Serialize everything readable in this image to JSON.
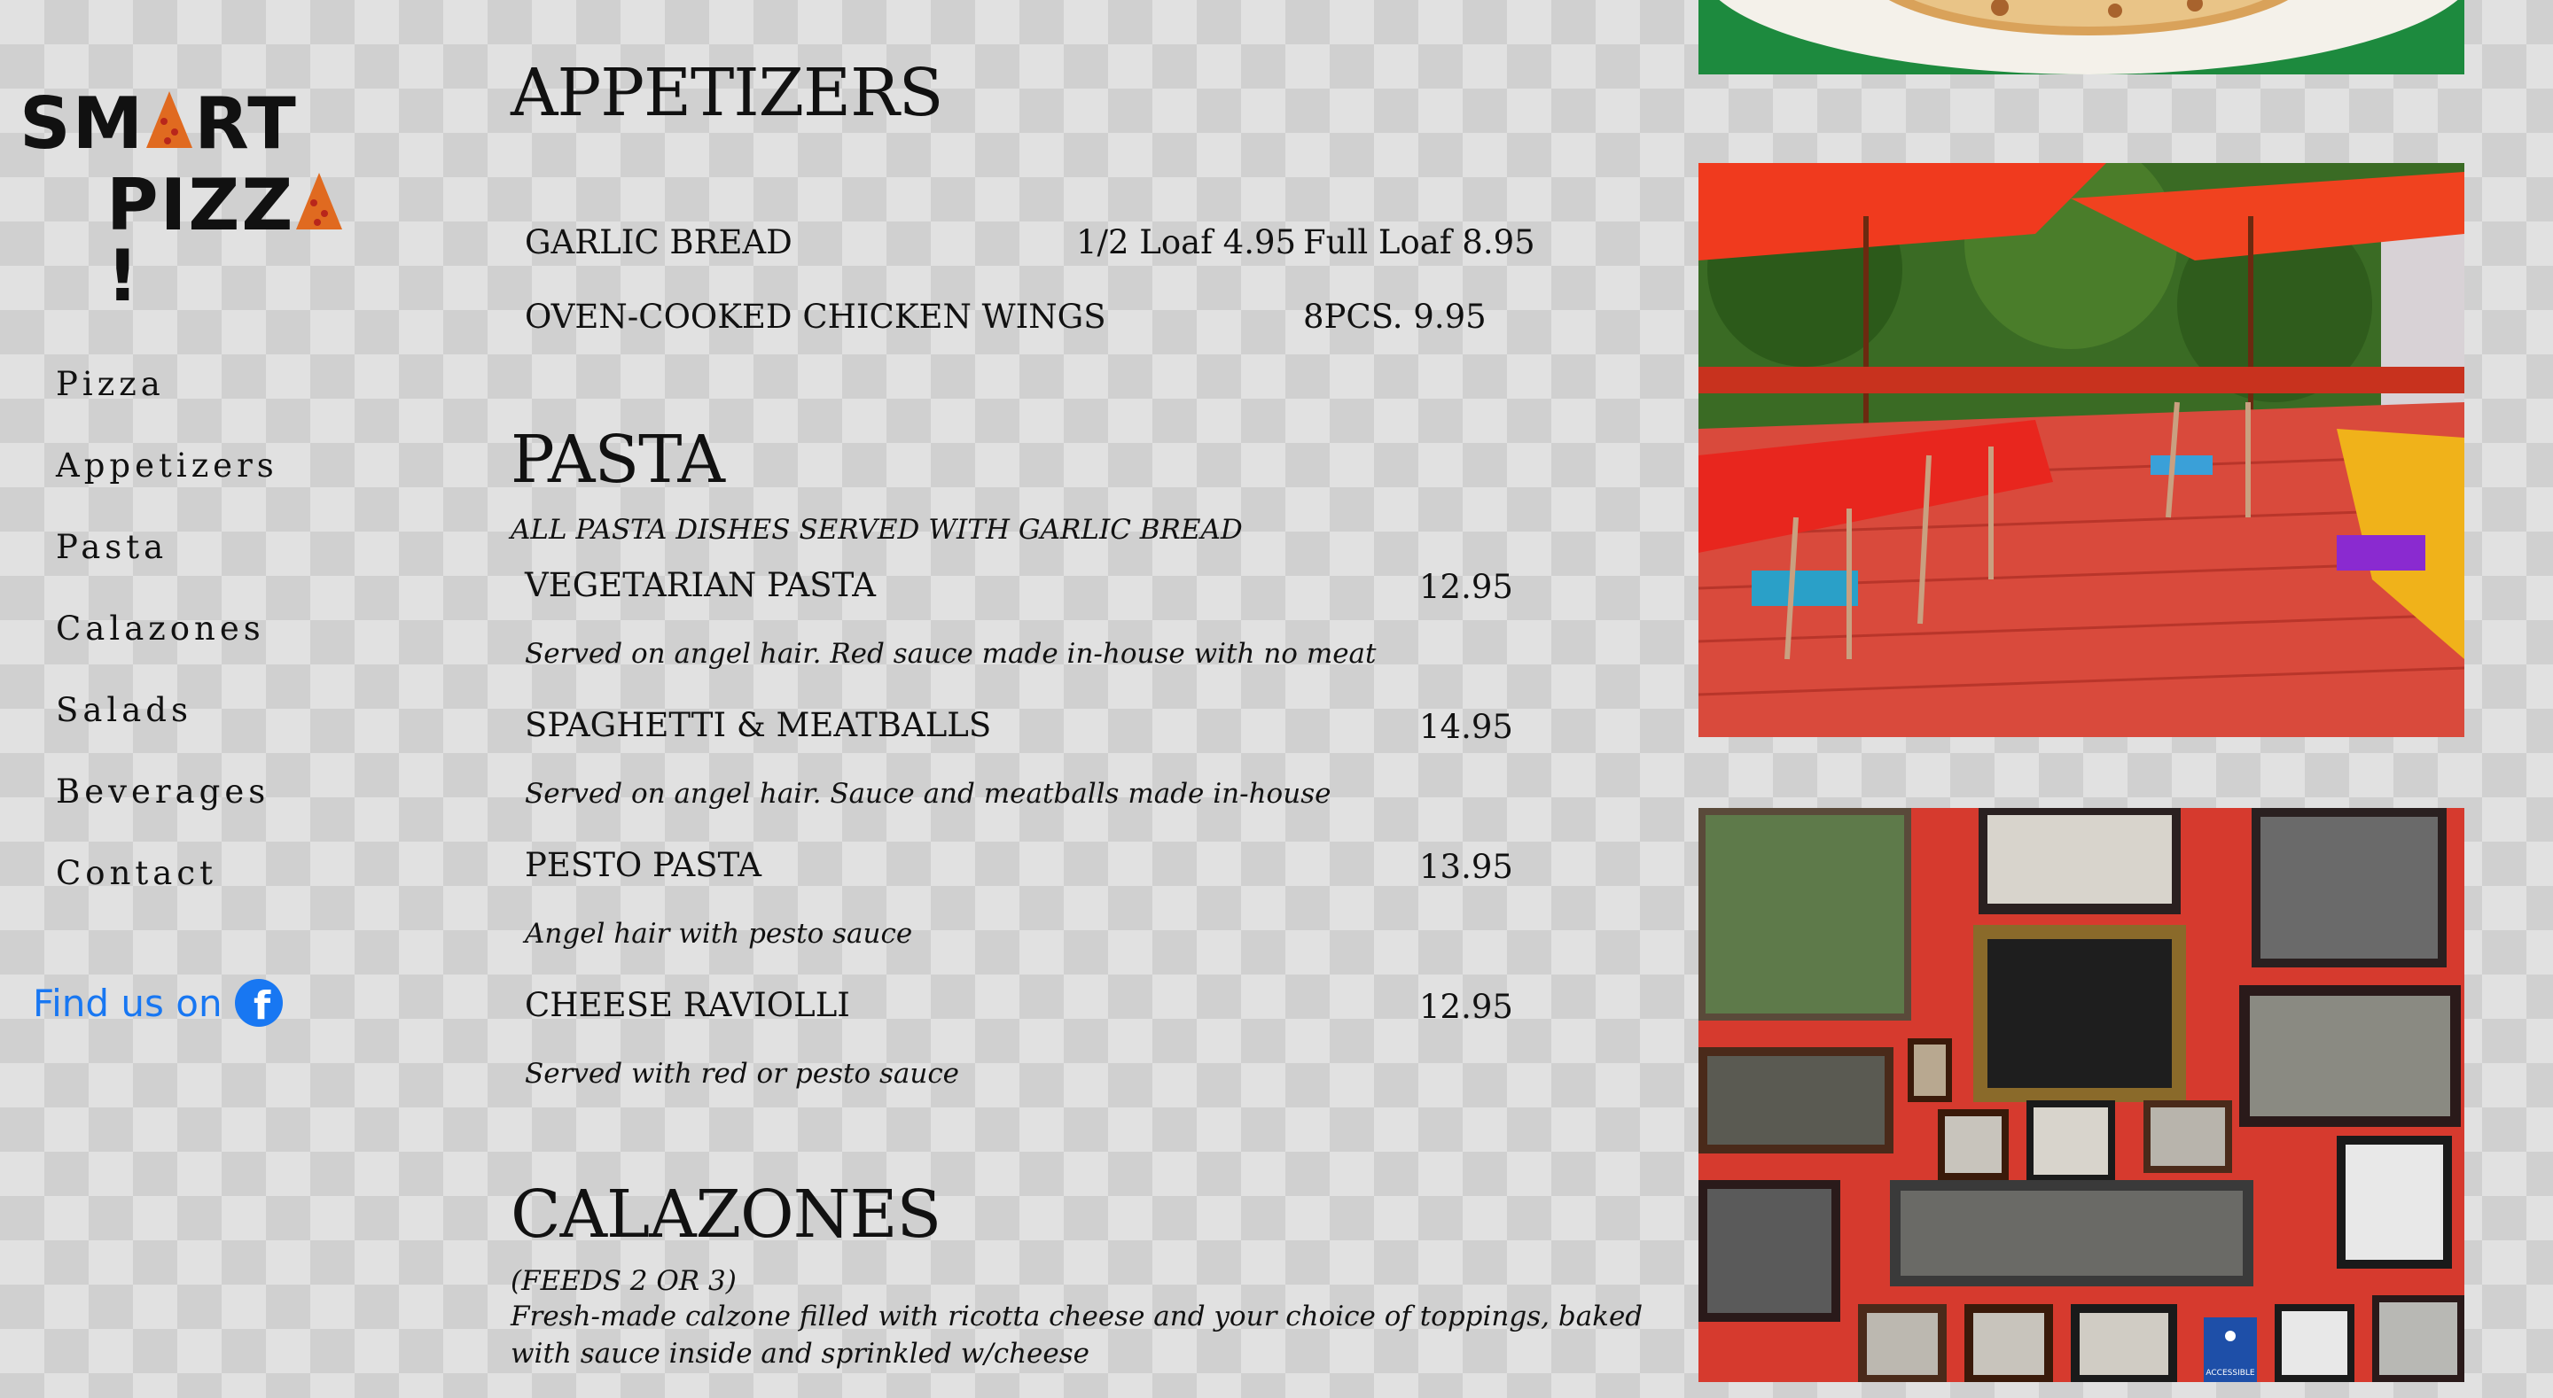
{
  "logo": {
    "line1": "SM",
    "line1b": "RT",
    "line2": "PIZZ",
    "line2b": "!"
  },
  "nav": {
    "items": [
      "Pizza",
      "Appetizers",
      "Pasta",
      "Calazones",
      "Salads",
      "Beverages",
      "Contact"
    ]
  },
  "social": {
    "label": "Find us on",
    "icon": "facebook-icon",
    "color": "#1877f2"
  },
  "appetizers": {
    "title": "APPETIZERS",
    "items": [
      {
        "name": "GARLIC BREAD",
        "price1": "1/2 Loaf 4.95",
        "price2": "Full Loaf 8.95"
      },
      {
        "name": "OVEN-COOKED CHICKEN WINGS",
        "price2": "8PCS. 9.95"
      }
    ]
  },
  "pasta": {
    "title": "PASTA",
    "note": "ALL PASTA DISHES SERVED WITH GARLIC BREAD",
    "items": [
      {
        "name": "VEGETARIAN PASTA",
        "price": "12.95",
        "desc": "Served on angel hair. Red sauce made in-house with no meat"
      },
      {
        "name": "SPAGHETTI & MEATBALLS",
        "price": "14.95",
        "desc": "Served on angel hair. Sauce and meatballs made in-house"
      },
      {
        "name": "PESTO PASTA",
        "price": "13.95",
        "desc": "Angel hair with pesto sauce"
      },
      {
        "name": "CHEESE RAVIOLLI",
        "price": "12.95",
        "desc": "Served with red or pesto sauce"
      }
    ]
  },
  "calazones": {
    "title": "CALAZONES",
    "feeds": "(FEEDS 2 OR 3)",
    "desc_line1": "Fresh-made calzone filled with ricotta cheese and your choice of toppings, baked",
    "desc_line2": "with sauce inside and sprinkled w/cheese"
  },
  "photos": {
    "accessible_label": "ACCESSIBLE"
  }
}
